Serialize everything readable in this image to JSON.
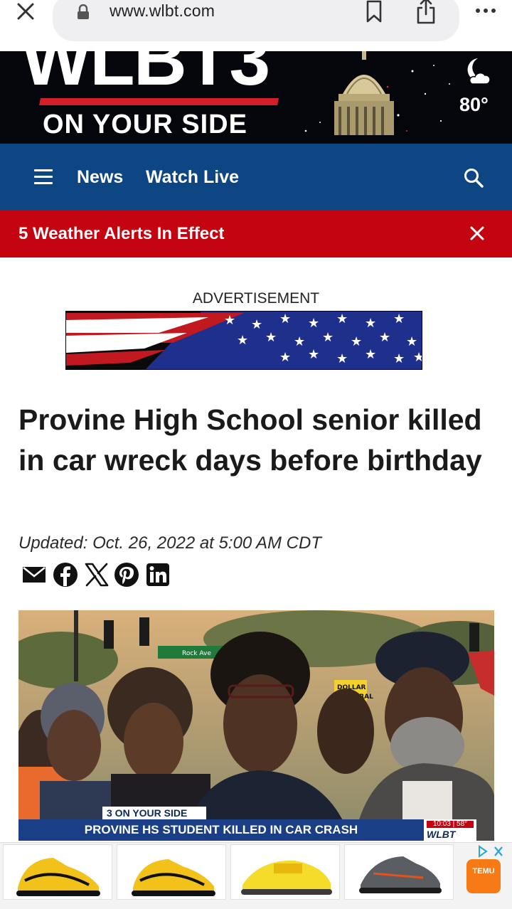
{
  "browser": {
    "url": "www.wlbt.com"
  },
  "brand": {
    "logo": "WLBT3",
    "tagline": "ON YOUR SIDE",
    "temperature": "80°",
    "weather_icon": "moon-cloud-icon"
  },
  "nav": {
    "items": [
      "News",
      "Watch Live"
    ]
  },
  "alert": {
    "text": "5 Weather Alerts In Effect"
  },
  "ad": {
    "label": "ADVERTISEMENT"
  },
  "article": {
    "headline": "Provine High School senior killed in car wreck days before birthday",
    "updated": "Updated: Oct. 26, 2022 at 5:00 AM CDT",
    "share_icons": [
      "email-icon",
      "facebook-icon",
      "x-icon",
      "pinterest-icon",
      "linkedin-icon"
    ]
  },
  "video": {
    "lower_third_tag": "3 ON YOUR SIDE",
    "lower_third_title": "PROVINE HS STUDENT KILLED IN CAR CRASH",
    "clock": "10:03 | 58°",
    "station": "WLBT",
    "sign_dollar": "DOLLAR GENERAL",
    "street_sign": "Rock Ave"
  },
  "bottom_ad": {
    "brand": "TEMU"
  },
  "colors": {
    "nav_blue": "#0d4682",
    "alert_red": "#c40511",
    "brand_black": "#05060b"
  }
}
